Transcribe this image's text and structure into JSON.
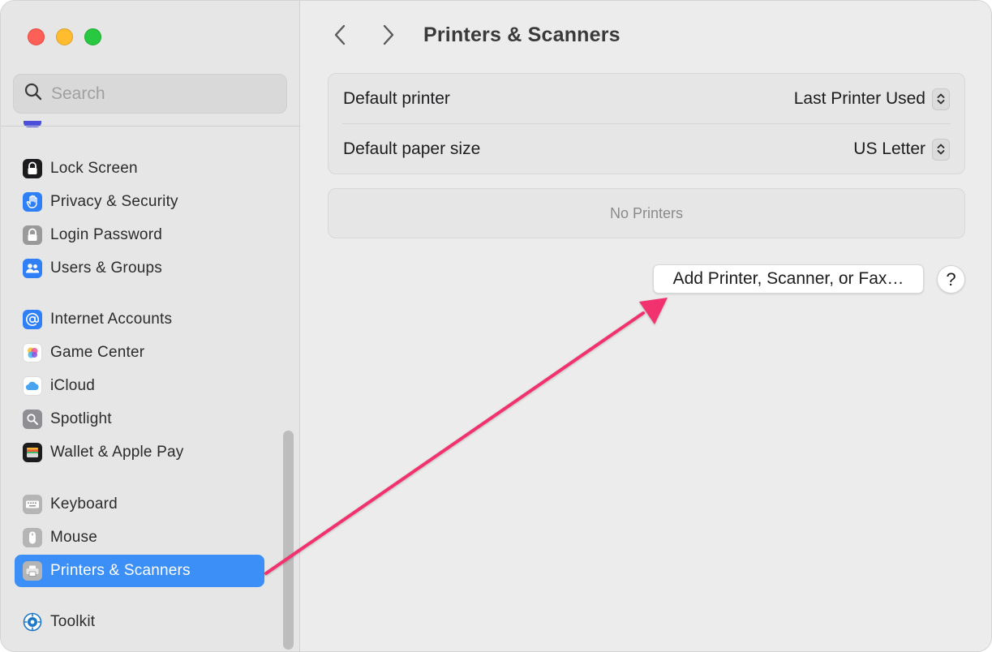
{
  "window": {
    "title": "Printers & Scanners"
  },
  "sidebar": {
    "search_placeholder": "Search",
    "items": [
      {
        "label": "Lock Screen",
        "icon": "lock-icon",
        "color": "#1c1c1e"
      },
      {
        "label": "Privacy & Security",
        "icon": "hand-icon",
        "color": "#2f80f6"
      },
      {
        "label": "Login Password",
        "icon": "lock-icon",
        "color": "#9a9a9a"
      },
      {
        "label": "Users & Groups",
        "icon": "users-icon",
        "color": "#2f80f6"
      },
      {
        "label": "Internet Accounts",
        "icon": "at-icon",
        "color": "#2f80f6"
      },
      {
        "label": "Game Center",
        "icon": "game-center-icon",
        "color": "#ffffff"
      },
      {
        "label": "iCloud",
        "icon": "cloud-icon",
        "color": "#ffffff"
      },
      {
        "label": "Spotlight",
        "icon": "magnifier-icon",
        "color": "#8e8e93"
      },
      {
        "label": "Wallet & Apple Pay",
        "icon": "wallet-icon",
        "color": "#1c1c1e"
      },
      {
        "label": "Keyboard",
        "icon": "keyboard-icon",
        "color": "#b5b5b5"
      },
      {
        "label": "Mouse",
        "icon": "mouse-icon",
        "color": "#b5b5b5"
      },
      {
        "label": "Printers & Scanners",
        "icon": "printer-icon",
        "color": "#b5b5b5",
        "selected": true
      },
      {
        "label": "Toolkit",
        "icon": "toolkit-icon",
        "color": "#2f80f6"
      }
    ]
  },
  "main": {
    "title": "Printers & Scanners",
    "settings": [
      {
        "label": "Default printer",
        "value": "Last Printer Used"
      },
      {
        "label": "Default paper size",
        "value": "US Letter"
      }
    ],
    "empty_message": "No Printers",
    "add_button": "Add Printer, Scanner, or Fax…",
    "help_button": "?"
  },
  "colors": {
    "selection": "#3b8ff6",
    "annotation_arrow": "#f2306e"
  }
}
